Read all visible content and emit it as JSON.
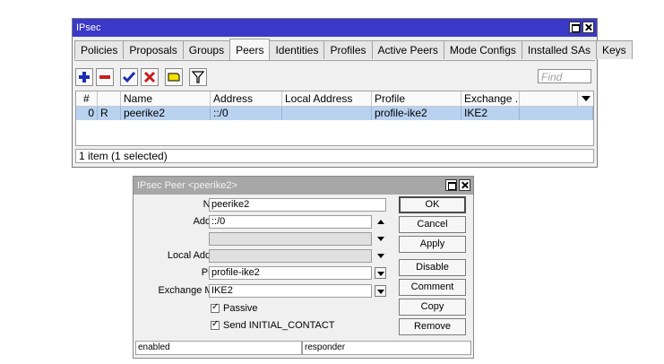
{
  "main_window": {
    "title": "IPsec",
    "tabs": [
      "Policies",
      "Proposals",
      "Groups",
      "Peers",
      "Identities",
      "Profiles",
      "Active Peers",
      "Mode Configs",
      "Installed SAs",
      "Keys"
    ],
    "active_tab": "Peers",
    "find_placeholder": "Find",
    "columns": [
      "#",
      "",
      "Name",
      "Address",
      "Local Address",
      "Profile",
      "Exchange ...",
      ""
    ],
    "rows": [
      {
        "num": "0",
        "flag": "R",
        "name": "peerike2",
        "address": "::/0",
        "local_address": "",
        "profile": "profile-ike2",
        "exchange": "IKE2"
      }
    ],
    "status": "1 item (1 selected)",
    "colors": {
      "title_bar": "#3a39c8",
      "selected_row": "#b8d2f0"
    }
  },
  "dialog": {
    "title": "IPsec Peer <peerike2>",
    "fields": {
      "name": {
        "label": "Name:",
        "value": "peerike2"
      },
      "address": {
        "label": "Address:",
        "value": "::/0"
      },
      "port": {
        "label": "Port:",
        "value": ""
      },
      "local_address": {
        "label": "Local Address:",
        "value": ""
      },
      "profile": {
        "label": "Profile:",
        "value": "profile-ike2"
      },
      "exchange_mode": {
        "label": "Exchange Mode:",
        "value": "IKE2"
      }
    },
    "checkboxes": {
      "passive": {
        "label": "Passive",
        "checked": true
      },
      "send_initial_contact": {
        "label": "Send INITIAL_CONTACT",
        "checked": true
      }
    },
    "buttons": {
      "ok": "OK",
      "cancel": "Cancel",
      "apply": "Apply",
      "disable": "Disable",
      "comment": "Comment",
      "copy": "Copy",
      "remove": "Remove"
    },
    "status_left": "enabled",
    "status_right": "responder"
  }
}
